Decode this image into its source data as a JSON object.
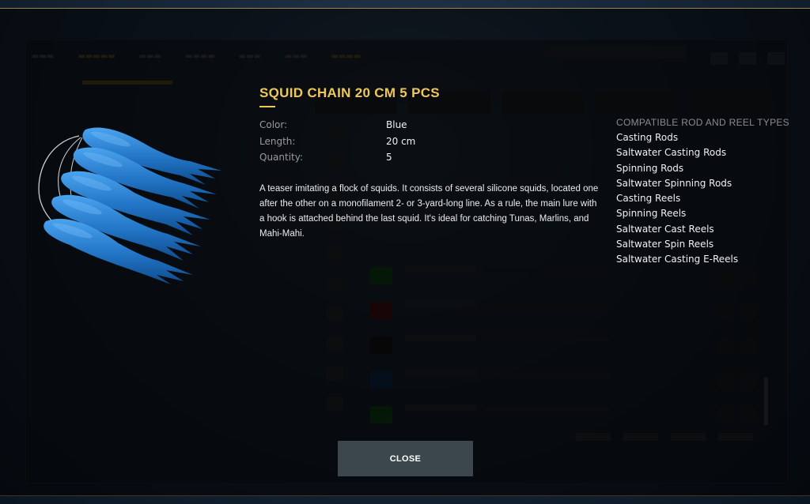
{
  "item": {
    "title": "SQUID CHAIN 20 CM 5 PCS",
    "image_icon": "blue-squid-chain-lure",
    "attributes": [
      {
        "label": "Color:",
        "value": "Blue"
      },
      {
        "label": "Length:",
        "value": "20 cm"
      },
      {
        "label": "Quantity:",
        "value": "5"
      }
    ],
    "description": "A teaser imitating a flock of squids. It consists of several silicone squids, located one after the other on a monofilament 2- or 3-yard-long line. As a rule, the main lure with a hook is attached behind the last squid. It's ideal for catching Tunas, Marlins, and Mahi-Mahi."
  },
  "compatibility": {
    "title": "COMPATIBLE ROD AND REEL TYPES",
    "items": [
      "Casting Rods",
      "Saltwater Casting Rods",
      "Spinning Rods",
      "Saltwater Spinning Rods",
      "Casting Reels",
      "Spinning Reels",
      "Saltwater Cast Reels",
      "Saltwater Spin Reels",
      "Saltwater Casting E-Reels"
    ]
  },
  "actions": {
    "close_label": "CLOSE"
  },
  "colors": {
    "accent_gold": "#f0c85a",
    "lure_blue": "#2a7fd0",
    "button_bg": "#3b474d"
  }
}
